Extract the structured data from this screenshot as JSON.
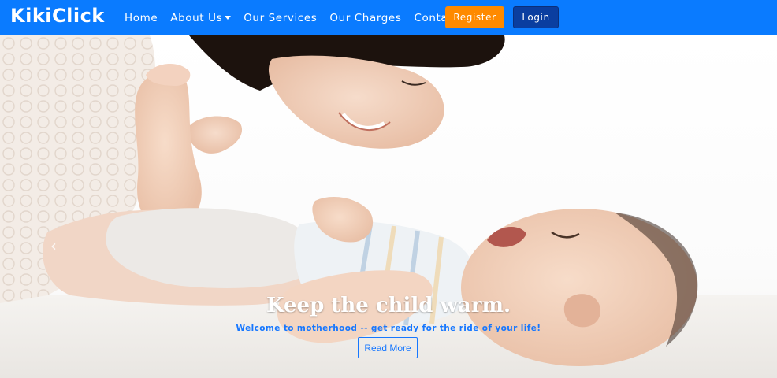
{
  "brand": "KikiClick",
  "nav": {
    "items": [
      "Home",
      "About Us",
      "Our Services",
      "Our Charges",
      "Contact Us"
    ],
    "register": "Register",
    "login": "Login"
  },
  "hero": {
    "title": "Keep the child warm.",
    "subtitle": "Welcome to motherhood -- get ready for the ride of your life!",
    "button": "Read More",
    "prev_arrow": "‹"
  },
  "colors": {
    "navbar": "#0a7bff",
    "register": "#ff8a00",
    "login": "#0a3ea0",
    "accent": "#1677ff"
  }
}
